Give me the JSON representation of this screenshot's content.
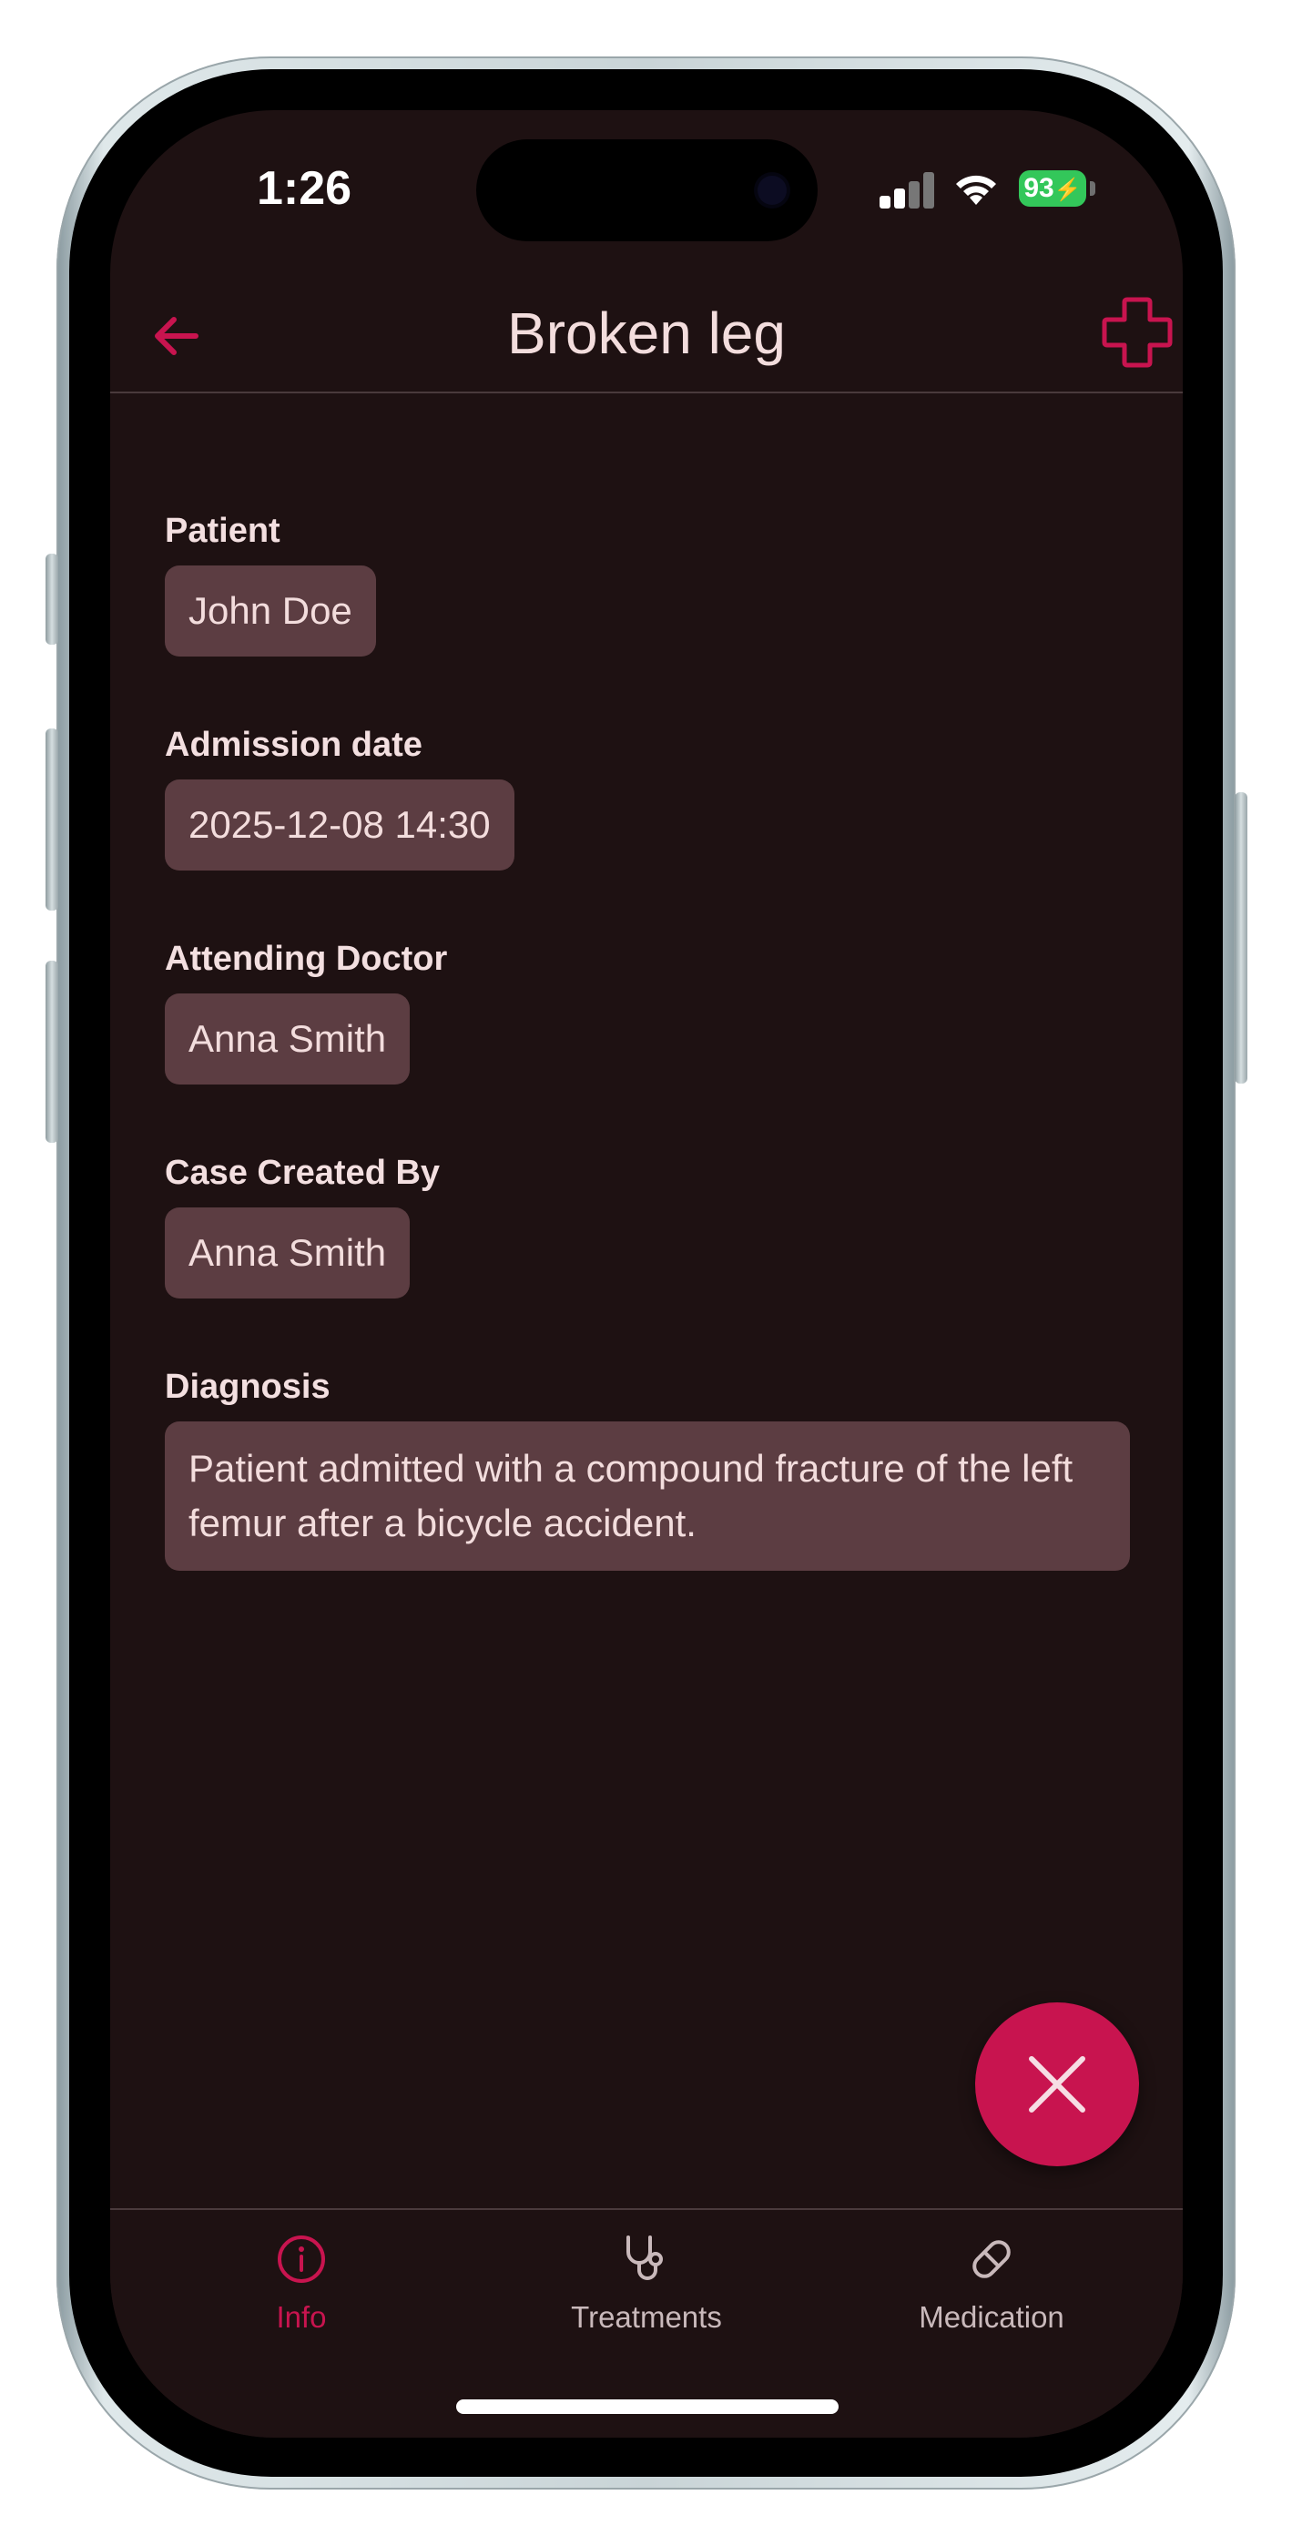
{
  "status_bar": {
    "time": "1:26",
    "battery": "93"
  },
  "app_bar": {
    "title": "Broken leg",
    "back_icon": "arrow-left-icon",
    "action_icon": "medical-cross-icon"
  },
  "case_fields": [
    {
      "label": "Patient",
      "value": "John Doe"
    },
    {
      "label": "Admission date",
      "value": "2025-12-08 14:30"
    },
    {
      "label": "Attending Doctor",
      "value": "Anna Smith"
    },
    {
      "label": "Case Created By",
      "value": "Anna Smith"
    },
    {
      "label": "Diagnosis",
      "value": "Patient admitted with a compound fracture of the left femur after a bicycle accident."
    }
  ],
  "fab": {
    "icon": "close-icon"
  },
  "bottom_nav": {
    "items": [
      {
        "label": "Info",
        "icon": "info-icon",
        "active": true
      },
      {
        "label": "Treatments",
        "icon": "stethoscope-icon",
        "active": false
      },
      {
        "label": "Medication",
        "icon": "pill-icon",
        "active": false
      }
    ]
  },
  "colors": {
    "background": "#1e1112",
    "accent": "#c8144f",
    "chip": "#5c3d42",
    "text": "#f3dddd",
    "inactive": "#c9b9bb"
  }
}
